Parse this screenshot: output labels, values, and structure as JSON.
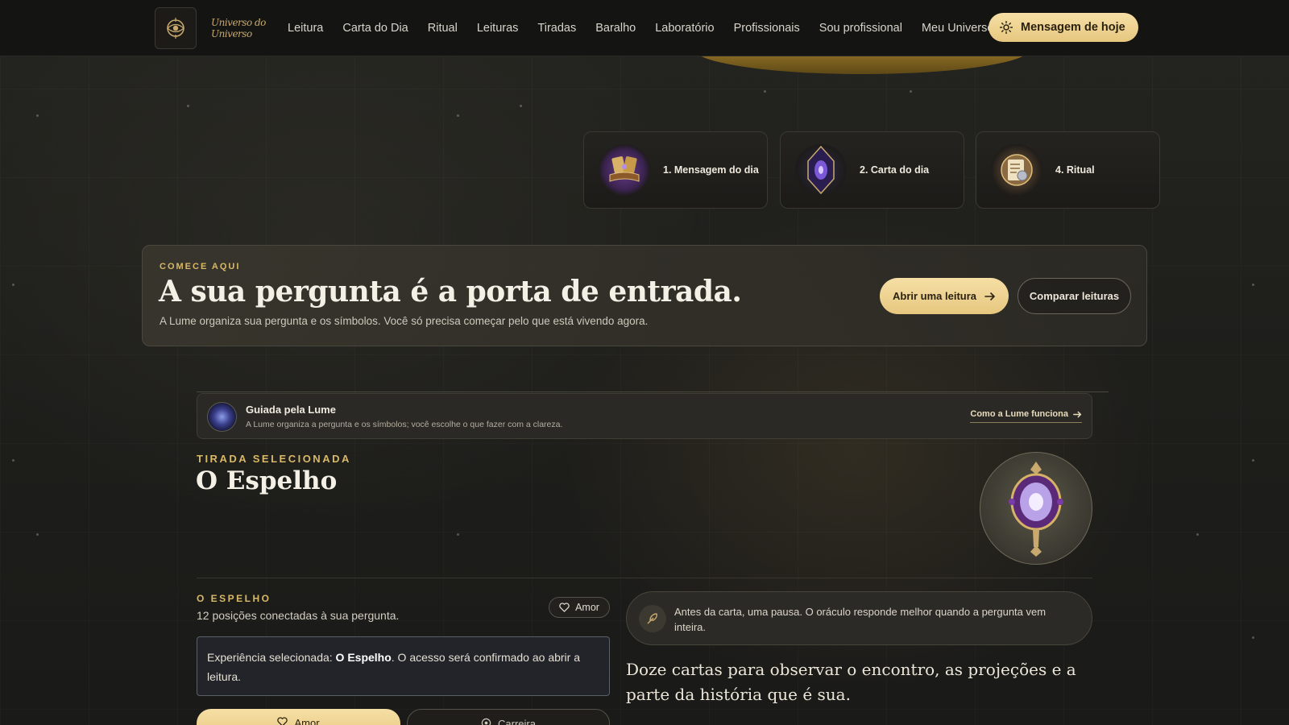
{
  "header": {
    "brand": "Universo do Universo",
    "nav": [
      "Leitura",
      "Carta do Dia",
      "Ritual",
      "Leituras",
      "Tiradas",
      "Baralho",
      "Laboratório",
      "Profissionais",
      "Sou profissional",
      "Meu Universo"
    ],
    "cta": "Mensagem de hoje"
  },
  "steps": [
    {
      "label": "1. Mensagem do dia",
      "icon": "book-cards-icon"
    },
    {
      "label": "2. Carta do dia",
      "icon": "crystal-card-icon"
    },
    {
      "label": "4. Ritual",
      "icon": "ritual-scroll-icon"
    }
  ],
  "start": {
    "kicker": "COMECE AQUI",
    "title": "A sua pergunta é a porta de entrada.",
    "subtitle": "A Lume organiza sua pergunta e os símbolos. Você só precisa começar pelo que está vivendo agora.",
    "primary_button": "Abrir uma leitura",
    "secondary_button": "Comparar leituras"
  },
  "guide": {
    "title": "Guiada pela Lume",
    "subtitle": "A Lume organiza a pergunta e os símbolos; você escolhe o que fazer com a clareza.",
    "link": "Como a Lume funciona"
  },
  "selected": {
    "kicker": "TIRADA SELECIONADA",
    "title": "O Espelho"
  },
  "spread": {
    "kicker": "O ESPELHO",
    "subtitle": "12 posições conectadas à sua pergunta.",
    "chip": "Amor",
    "experience_prefix": "Experiência selecionada: ",
    "experience_name": "O Espelho",
    "experience_suffix": ". O acesso será confirmado ao abrir a leitura.",
    "options": [
      "Amor",
      "Carreira"
    ]
  },
  "pause": {
    "text": "Antes da carta, uma pausa. O oráculo responde melhor quando a pergunta vem inteira."
  },
  "intro": "Doze cartas para observar o encontro, as projeções e a parte da história que é sua.",
  "colors": {
    "accent_gold": "#e6c77f",
    "kicker_gold": "#d9b866",
    "background": "#1e1e1b"
  }
}
